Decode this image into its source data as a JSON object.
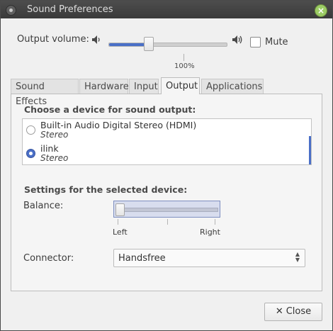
{
  "window": {
    "title": "Sound Preferences"
  },
  "volume": {
    "label": "Output volume:",
    "level": 0.34,
    "percent_label": "100%",
    "mute_label": "Mute",
    "mute_checked": false
  },
  "tabs": [
    {
      "label": "Sound Effects",
      "active": false
    },
    {
      "label": "Hardware",
      "active": false
    },
    {
      "label": "Input",
      "active": false
    },
    {
      "label": "Output",
      "active": true
    },
    {
      "label": "Applications",
      "active": false
    }
  ],
  "output": {
    "heading": "Choose a device for sound output:",
    "devices": [
      {
        "name": "Built-in Audio Digital Stereo (HDMI)",
        "profile": "Stereo",
        "selected": false
      },
      {
        "name": "ilink",
        "profile": "Stereo",
        "selected": true
      }
    ],
    "settings_heading": "Settings for the selected device:",
    "balance": {
      "label": "Balance:",
      "value": 0.0,
      "left_label": "Left",
      "right_label": "Right"
    },
    "connector": {
      "label": "Connector:",
      "value": "Handsfree"
    }
  },
  "footer": {
    "close_label": "Close"
  },
  "colors": {
    "accent": "#4a6fc7",
    "titlebar": "#3d3d3d",
    "close_green": "#9ccc65"
  }
}
